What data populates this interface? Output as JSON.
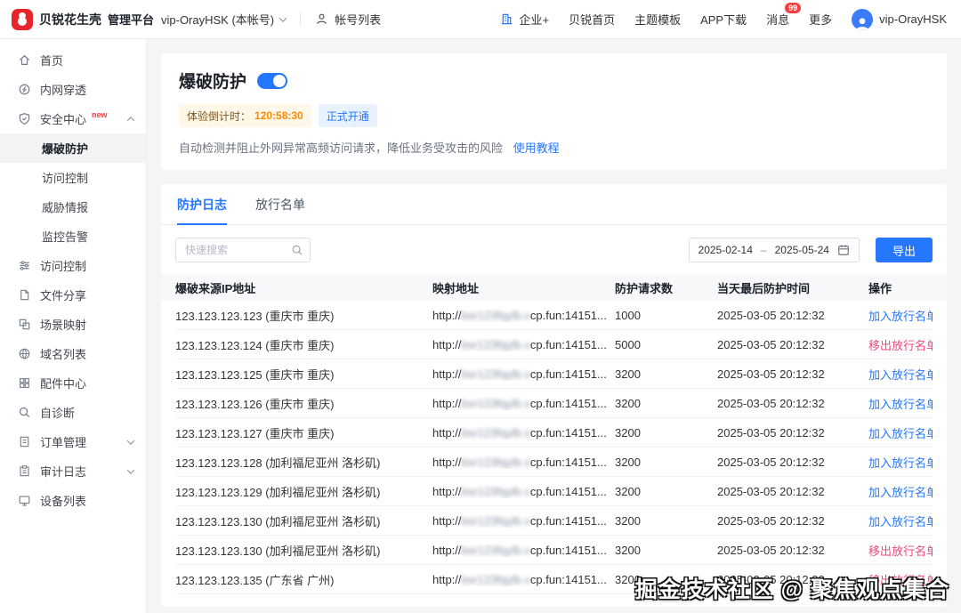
{
  "header": {
    "logo": "贝锐花生壳",
    "platform": "管理平台",
    "account_selector": "vip-OrayHSK (本帐号)",
    "account_list": "帐号列表",
    "nav_enterprise": "企业+",
    "nav_links": [
      "贝锐首页",
      "主题模板",
      "APP下载",
      "消息",
      "更多"
    ],
    "message_badge": "99",
    "username": "vip-OrayHSK"
  },
  "sidebar": {
    "items": [
      {
        "label": "首页",
        "icon": "home-icon"
      },
      {
        "label": "内网穿透",
        "icon": "tunnel-icon"
      },
      {
        "label": "安全中心",
        "icon": "security-shield-icon",
        "badge": "new"
      },
      {
        "label": "爆破防护"
      },
      {
        "label": "访问控制"
      },
      {
        "label": "威胁情报"
      },
      {
        "label": "监控告警"
      },
      {
        "label": "访问控制",
        "icon": "access-control-icon"
      },
      {
        "label": "文件分享",
        "icon": "file-share-icon"
      },
      {
        "label": "场景映射",
        "icon": "scene-mapping-icon"
      },
      {
        "label": "域名列表",
        "icon": "domain-list-icon"
      },
      {
        "label": "配件中心",
        "icon": "addons-icon"
      },
      {
        "label": "自诊断",
        "icon": "diagnose-icon"
      },
      {
        "label": "订单管理",
        "icon": "order-icon"
      },
      {
        "label": "审计日志",
        "icon": "audit-icon"
      },
      {
        "label": "设备列表",
        "icon": "device-icon"
      }
    ]
  },
  "page": {
    "title": "爆破防护",
    "countdown_label": "体验倒计时：",
    "countdown_value": "120:58:30",
    "activate_badge": "正式开通",
    "description": "自动检测并阻止外网异常高频访问请求，降低业务受攻击的风险",
    "tutorial_link": "使用教程",
    "tabs": [
      "防护日志",
      "放行名单"
    ],
    "search_placeholder": "快速搜索",
    "date_start": "2025-02-14",
    "date_separator": "–",
    "date_end": "2025-05-24",
    "export_button": "导出"
  },
  "table": {
    "headers": [
      "爆破来源IP地址",
      "映射地址",
      "防护请求数",
      "当天最后防护时间",
      "操作"
    ],
    "mapped_prefix": "http://",
    "mapped_blurred": "bsr123fqylb.v",
    "mapped_suffix": "cp.fun:14151...",
    "rows": [
      {
        "ip": "123.123.123.123 (重庆市 重庆)",
        "requests": "1000",
        "time": "2025-03-05 20:12:32",
        "action": "加入放行名单"
      },
      {
        "ip": "123.123.123.124 (重庆市 重庆)",
        "requests": "5000",
        "time": "2025-03-05 20:12:32",
        "action": "移出放行名单"
      },
      {
        "ip": "123.123.123.125 (重庆市 重庆)",
        "requests": "3200",
        "time": "2025-03-05 20:12:32",
        "action": "加入放行名单"
      },
      {
        "ip": "123.123.123.126 (重庆市 重庆)",
        "requests": "3200",
        "time": "2025-03-05 20:12:32",
        "action": "加入放行名单"
      },
      {
        "ip": "123.123.123.127 (重庆市 重庆)",
        "requests": "3200",
        "time": "2025-03-05 20:12:32",
        "action": "加入放行名单"
      },
      {
        "ip": "123.123.123.128 (加利福尼亚州 洛杉矶)",
        "requests": "3200",
        "time": "2025-03-05 20:12:32",
        "action": "加入放行名单"
      },
      {
        "ip": "123.123.123.129 (加利福尼亚州 洛杉矶)",
        "requests": "3200",
        "time": "2025-03-05 20:12:32",
        "action": "加入放行名单"
      },
      {
        "ip": "123.123.123.130 (加利福尼亚州 洛杉矶)",
        "requests": "3200",
        "time": "2025-03-05 20:12:32",
        "action": "加入放行名单"
      },
      {
        "ip": "123.123.123.130 (加利福尼亚州 洛杉矶)",
        "requests": "3200",
        "time": "2025-03-05 20:12:32",
        "action": "移出放行名单"
      },
      {
        "ip": "123.123.123.135 (广东省 广州)",
        "requests": "3200",
        "time": "2025-03-05 20:12:32",
        "action": "移出放行名单"
      }
    ]
  },
  "watermark": "掘金技术社区 @ 聚焦观点集合",
  "colors": {
    "primary": "#2577ff",
    "danger": "#f0497c",
    "orange": "#ff8a00",
    "brand_red": "#e8252d"
  }
}
